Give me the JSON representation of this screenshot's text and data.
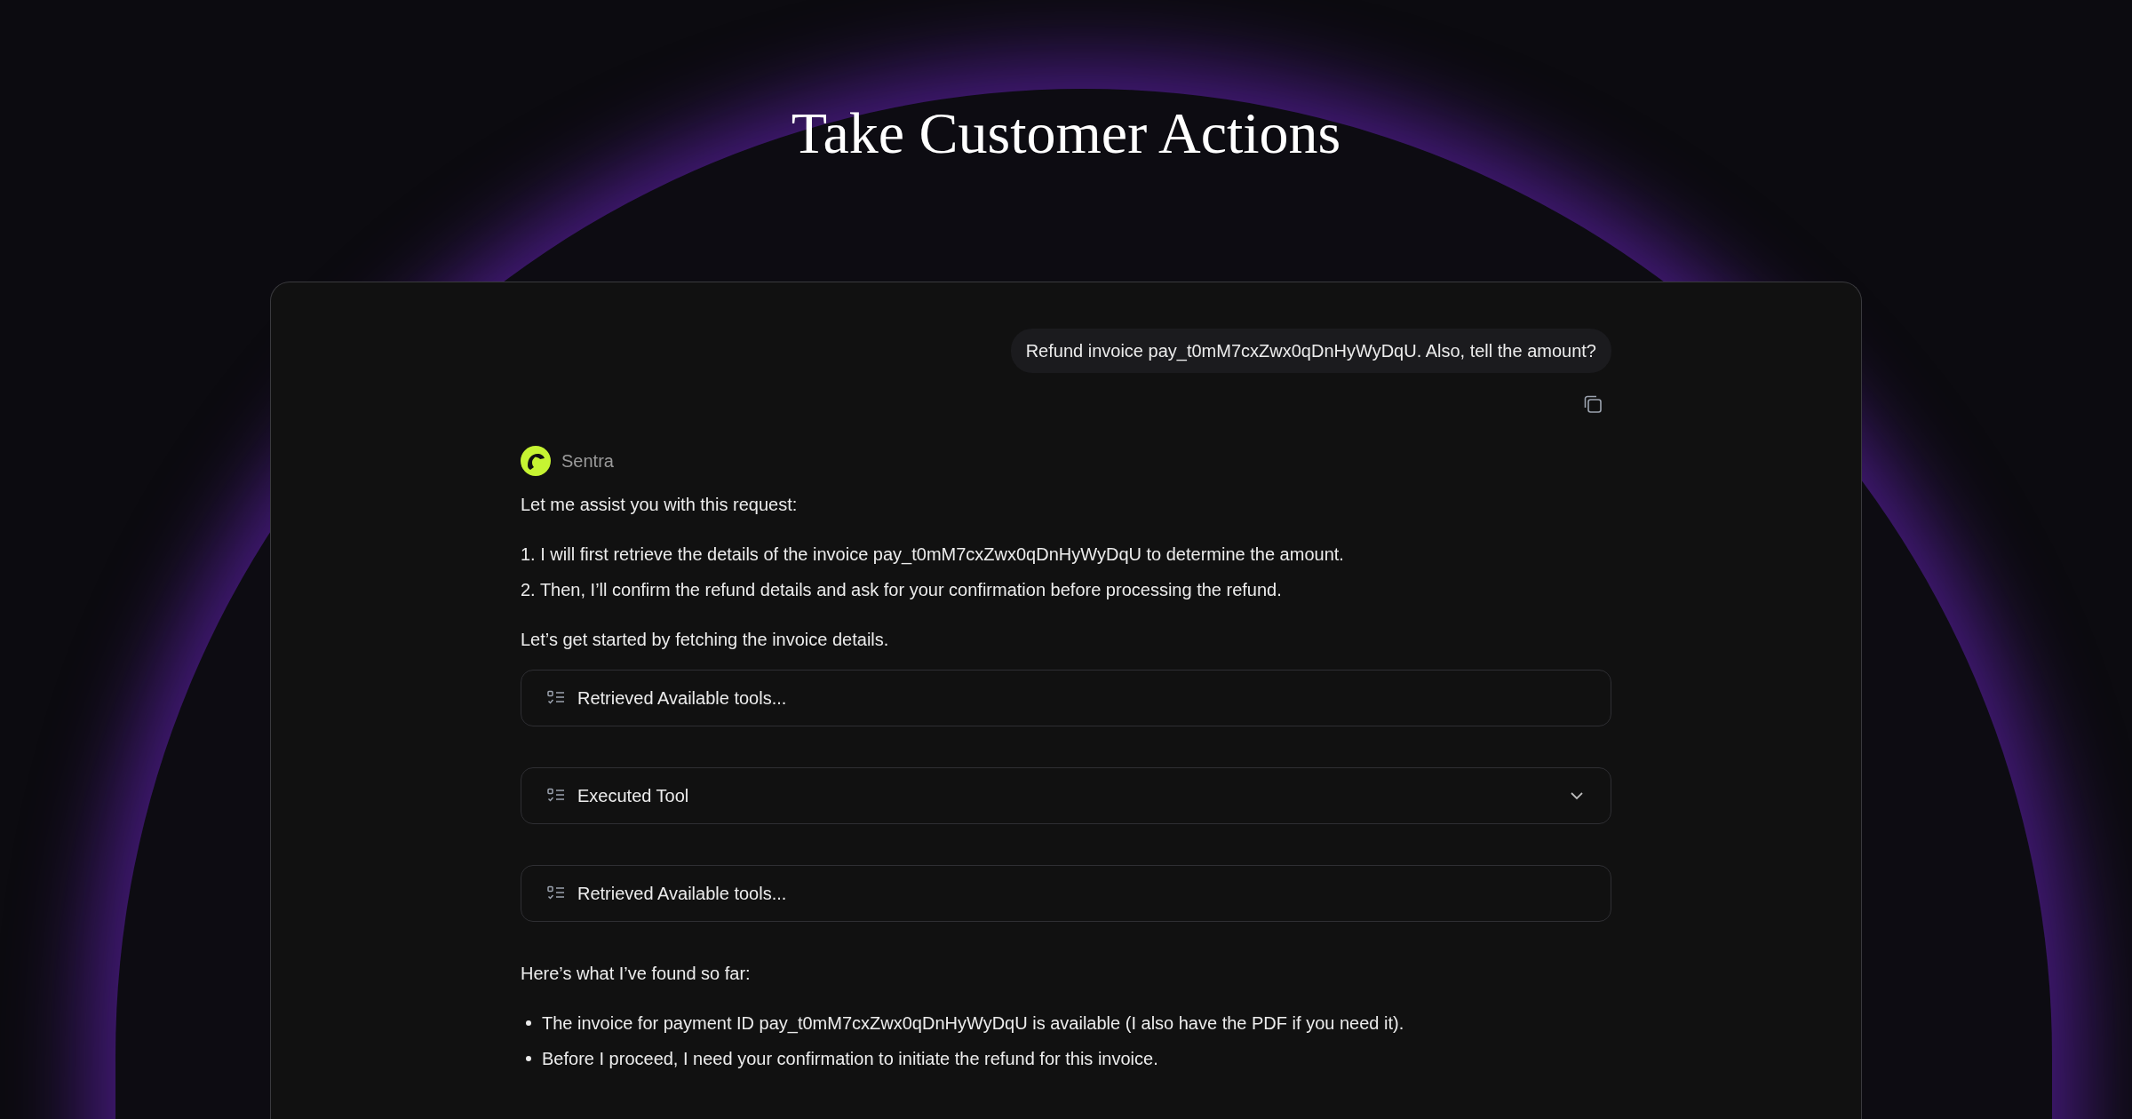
{
  "title": "Take Customer Actions",
  "user_message": {
    "text": "Refund invoice pay_t0mM7cxZwx0qDnHyWyDqU. Also, tell the amount?"
  },
  "assistant": {
    "name": "Sentra",
    "intro": "Let me assist you with this request:",
    "steps": [
      "1. I will first retrieve the details of the invoice pay_t0mM7cxZwx0qDnHyWyDqU to determine the amount.",
      "2. Then, I’ll confirm the refund details and ask for your confirmation before processing the refund."
    ],
    "lead": "Let’s get started by fetching the invoice details.",
    "tools": [
      {
        "label": "Retrieved Available tools...",
        "expandable": false
      },
      {
        "label": "Executed Tool",
        "expandable": true
      },
      {
        "label": "Retrieved Available tools...",
        "expandable": false
      }
    ],
    "summary": "Here’s what I’ve found so far:",
    "bullets": [
      "The invoice for payment ID pay_t0mM7cxZwx0qDnHyWyDqU is available (I also have the PDF if you need it).",
      "Before I proceed, I need your confirmation to initiate the refund for this invoice."
    ]
  }
}
